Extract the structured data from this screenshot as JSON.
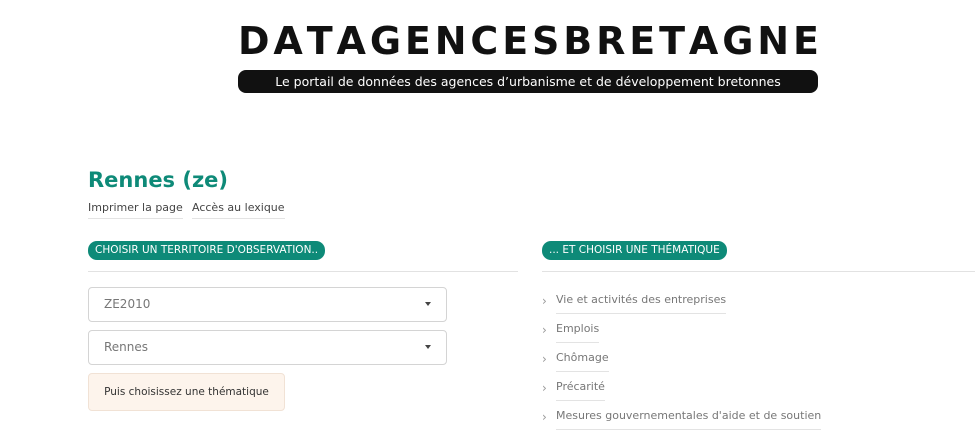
{
  "header": {
    "logo_letters": [
      "D",
      "A",
      "T",
      "A",
      "G",
      "E",
      "N",
      "C",
      "E",
      "S",
      "B",
      "R",
      "E",
      "T",
      "A",
      "G",
      "N",
      "E"
    ],
    "tagline": "Le portail de données des agences d’urbanisme et de développement bretonnes"
  },
  "page": {
    "title": "Rennes (ze)",
    "links": [
      "Imprimer la page",
      "Accès au lexique"
    ]
  },
  "territory": {
    "heading": "CHOISIR UN TERRITOIRE D'OBSERVATION..",
    "zoning_select": "ZE2010",
    "area_select": "Rennes",
    "note": "Puis choisissez une thématique"
  },
  "themes": {
    "heading": "... ET CHOISIR UNE THÉMATIQUE",
    "items": [
      "Vie et activités des entreprises",
      "Emplois",
      "Chômage",
      "Précarité",
      "Mesures gouvernementales d'aide et de soutien"
    ]
  }
}
